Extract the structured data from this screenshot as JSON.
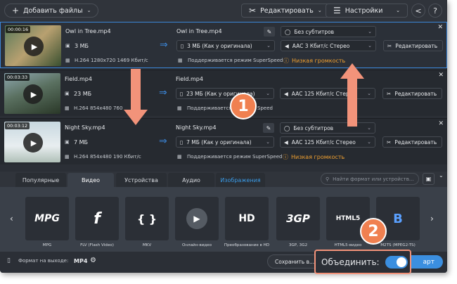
{
  "toolbar": {
    "add_files": "Добавить файлы",
    "edit": "Редактировать",
    "settings": "Настройки"
  },
  "files": [
    {
      "duration": "00:00:16",
      "name": "Owl in Tree.mp4",
      "size": "3 МБ",
      "codec": "H.264 1280x720 1469 Кбит/с",
      "out_name": "Owl in Tree.mp4",
      "out_size": "3 МБ (Как у оригинала)",
      "speed": "Поддерживается режим SuperSpeed",
      "subtitles": "Без субтитров",
      "audio": "AAC 3 Кбит/с Стерео",
      "warning": "Низкая громкость",
      "edit": "Редактировать"
    },
    {
      "duration": "00:03:33",
      "name": "Field.mp4",
      "size": "23 МБ",
      "codec": "H.264 854x480 760",
      "out_name": "Field.mp4",
      "out_size": "23 МБ (Как у оригинала)",
      "speed": "Поддерживается реж",
      "speed2": "Speed",
      "audio": "AAC 125 Кбит/с Стерео",
      "edit": "Редактировать"
    },
    {
      "duration": "00:03:12",
      "name": "Night Sky.mp4",
      "size": "7 МБ",
      "codec": "H.264 854x480 190 Кбит/с",
      "out_name": "Night Sky.mp4",
      "out_size": "7 МБ (Как у оригинала)",
      "speed": "Поддерживается режим SuperSpeed",
      "subtitles": "Без субтитров",
      "audio": "AAC 125 Кбит/с Стерео",
      "warning": "Низкая громкость",
      "edit": "Редактировать"
    }
  ],
  "tabs": [
    "Популярные",
    "Видео",
    "Устройства",
    "Аудио",
    "Изображения"
  ],
  "search_placeholder": "Найти формат или устройств...",
  "formats": [
    {
      "label": "MPG",
      "icon": "MPG"
    },
    {
      "label": "FLV (Flash Video)",
      "icon": "f"
    },
    {
      "label": "MKV",
      "icon": "{ }"
    },
    {
      "label": "Онлайн-видео",
      "icon": "▶"
    },
    {
      "label": "Преобразование в HD",
      "icon": "HD"
    },
    {
      "label": "3GP, 3G2",
      "icon": "3GP"
    },
    {
      "label": "HTML5-видео",
      "icon": "HTML5"
    },
    {
      "label": "M2TS (MPEG2-TS)",
      "icon": "B"
    }
  ],
  "bottom": {
    "output_label": "Формат на выходе:",
    "output_value": "MP4",
    "save": "Сохранить в...",
    "merge": "Объединить:",
    "start": "арт"
  },
  "annotations": {
    "one": "1",
    "two": "2"
  },
  "colors": {
    "accent": "#3b86d8",
    "annotation": "#f08050",
    "warning": "#f0a030"
  }
}
